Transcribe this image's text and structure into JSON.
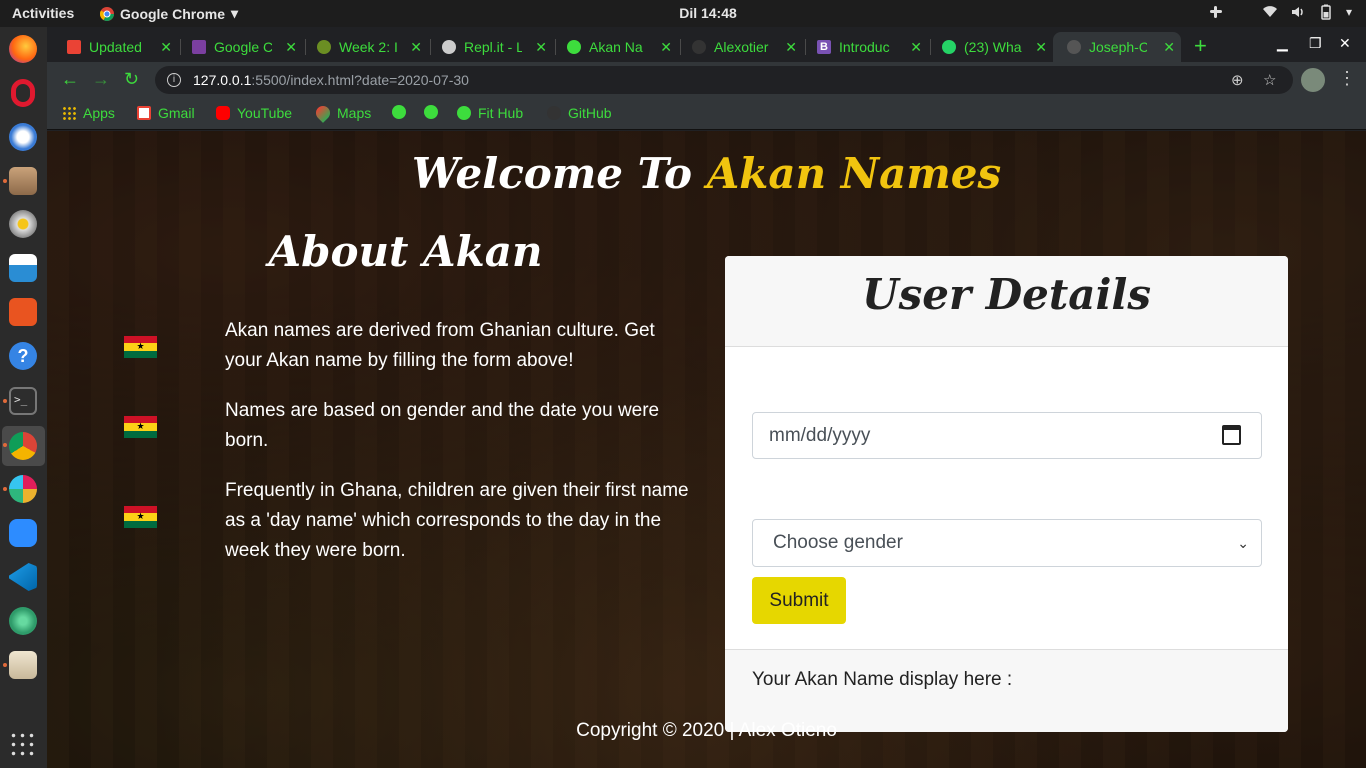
{
  "topbar": {
    "activities": "Activities",
    "app_name": "Google Chrome",
    "clock": "Dil 14:48"
  },
  "browser": {
    "tabs": [
      {
        "title": "Updated",
        "favicon": "gmail-icon",
        "color": "#ea4335"
      },
      {
        "title": "Google C",
        "favicon": "calendar-icon",
        "color": "#7b3fa0"
      },
      {
        "title": "Week 2: I",
        "favicon": "tree-icon",
        "color": "#6b8e23"
      },
      {
        "title": "Repl.it - L",
        "favicon": "replit-icon",
        "color": "#cccccc"
      },
      {
        "title": "Akan Na",
        "favicon": "globe-icon",
        "color": "#3ddc3d"
      },
      {
        "title": "Alexotier",
        "favicon": "github-icon",
        "color": "#333333"
      },
      {
        "title": "Introduc",
        "favicon": "bootstrap-icon",
        "color": "#7952b3"
      },
      {
        "title": "(23) Wha",
        "favicon": "whatsapp-icon",
        "color": "#25d366"
      },
      {
        "title": "Joseph-C",
        "favicon": "github-icon",
        "color": "#555555"
      }
    ],
    "new_tab": "+",
    "url_host": "127.0.0.1",
    "url_rest": ":5500/index.html?date=2020-07-30",
    "bookmarks": [
      {
        "label": "Apps",
        "icon": "apps-grid-icon",
        "color": "#e8b800"
      },
      {
        "label": "Gmail",
        "icon": "gmail-icon",
        "color": "#ea4335"
      },
      {
        "label": "YouTube",
        "icon": "youtube-icon",
        "color": "#ff0000"
      },
      {
        "label": "Maps",
        "icon": "maps-pin-icon",
        "color": "#34a853"
      },
      {
        "label": "",
        "icon": "globe-icon",
        "color": "#3ddc3d"
      },
      {
        "label": "",
        "icon": "globe-icon",
        "color": "#3ddc3d"
      },
      {
        "label": "Fit Hub",
        "icon": "globe-icon",
        "color": "#3ddc3d"
      },
      {
        "label": "GitHub",
        "icon": "github-icon",
        "color": "#333333"
      }
    ]
  },
  "page": {
    "welcome_prefix": "Welcome To ",
    "welcome_accent": "Akan Names",
    "about_title": "About Akan",
    "paragraphs": [
      "Akan names are derived from Ghanian culture. Get your Akan name by filling the form above!",
      "Names are based on gender and the date you were born.",
      "Frequently in Ghana, children are given their first name as a 'day name' which corresponds to the day in the week they were born."
    ],
    "flag_star": "★",
    "form": {
      "title": "User Details",
      "date_placeholder": "mm/dd/yyyy",
      "gender_placeholder": "Choose gender",
      "submit_label": "Submit",
      "result_label": "Your Akan Name display here :"
    },
    "copyright": "Copyright © 2020 | Alex Otieno"
  },
  "colors": {
    "accent": "#f1c40f",
    "submit": "#e6d700",
    "browser_green": "#3ddc3d"
  }
}
